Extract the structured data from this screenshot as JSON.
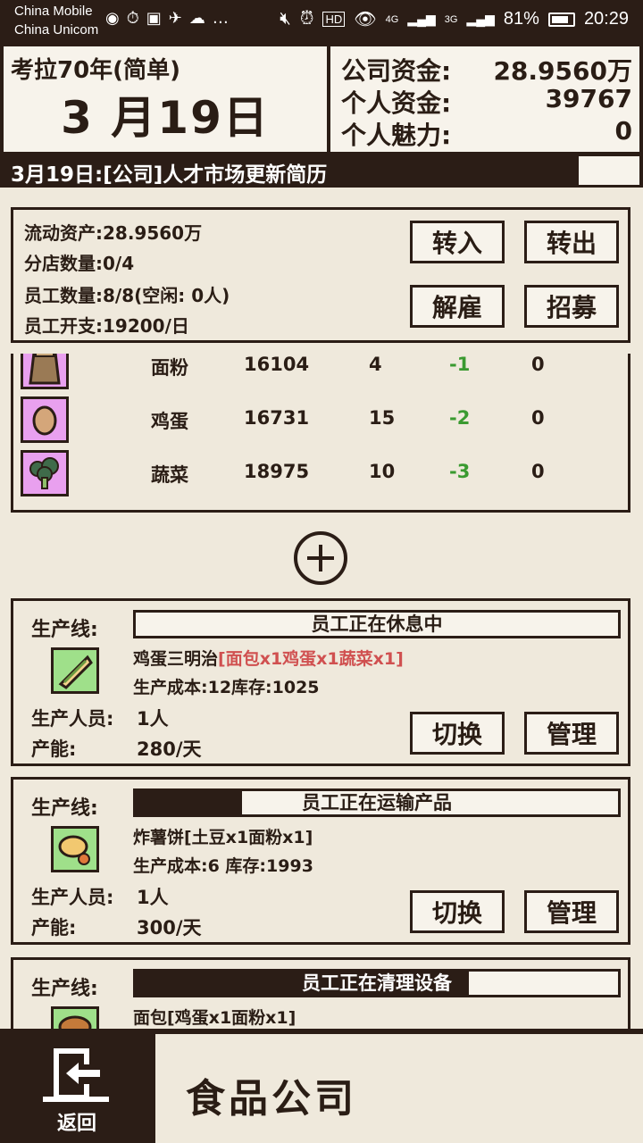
{
  "status_bar": {
    "carrier1": "China Mobile",
    "carrier2": "China Unicom",
    "battery": "81%",
    "time": "20:29",
    "signal1": "4G",
    "signal2": "3G"
  },
  "header": {
    "era": "考拉70年(简单)",
    "date": "3 月19日",
    "company_funds_label": "公司资金:",
    "company_funds": "28.9560万",
    "personal_funds_label": "个人资金:",
    "personal_funds": "39767",
    "charm_label": "个人魅力:",
    "charm": "0"
  },
  "news": "3月19日:[公司]人才市场更新简历",
  "assets": {
    "liquid": "流动资产:28.9560万",
    "branches": "分店数量:0/4",
    "employees": "员工数量:8/8(空闲: 0人)",
    "expense": "员工开支:19200/日",
    "btn_in": "转入",
    "btn_out": "转出",
    "btn_fire": "解雇",
    "btn_hire": "招募"
  },
  "inventory": [
    {
      "icon": "flour-sack-icon",
      "name": "面粉",
      "stock": "16104",
      "qty": "4",
      "delta": "-1",
      "extra": "0"
    },
    {
      "icon": "egg-icon",
      "name": "鸡蛋",
      "stock": "16731",
      "qty": "15",
      "delta": "-2",
      "extra": "0"
    },
    {
      "icon": "broccoli-icon",
      "name": "蔬菜",
      "stock": "18975",
      "qty": "10",
      "delta": "-3",
      "extra": "0"
    }
  ],
  "production_lines": [
    {
      "label": "生产线:",
      "status": "员工正在休息中",
      "progress": 0,
      "product": "鸡蛋三明治",
      "recipe": "[面包x1鸡蛋x1蔬菜x1]",
      "cost_stock": "生产成本:12库存:1025",
      "staff_label": "生产人员:",
      "staff": "1人",
      "capacity_label": "产能:",
      "capacity": "280/天",
      "btn_switch": "切换",
      "btn_manage": "管理"
    },
    {
      "label": "生产线:",
      "status": "员工正在运输产品",
      "progress": 0.22,
      "product": "炸薯饼[土豆x1面粉x1]",
      "recipe": "",
      "cost_stock": "生产成本:6  库存:1993",
      "staff_label": "生产人员:",
      "staff": "1人",
      "capacity_label": "产能:",
      "capacity": "300/天",
      "btn_switch": "切换",
      "btn_manage": "管理"
    },
    {
      "label": "生产线:",
      "status": "员工正在清理设备",
      "progress": 0.69,
      "product": "面包[鸡蛋x1面粉x1]",
      "recipe": ""
    }
  ],
  "bottom": {
    "back_label": "返回",
    "title": "食品公司"
  },
  "colors": {
    "dark": "#2b1d16",
    "paper": "#efe9dc",
    "negative_green": "#3a9a30",
    "recipe_red": "#d05050",
    "icon_bg_purple": "#e9a0ef",
    "icon_bg_green": "#9fe08a"
  }
}
